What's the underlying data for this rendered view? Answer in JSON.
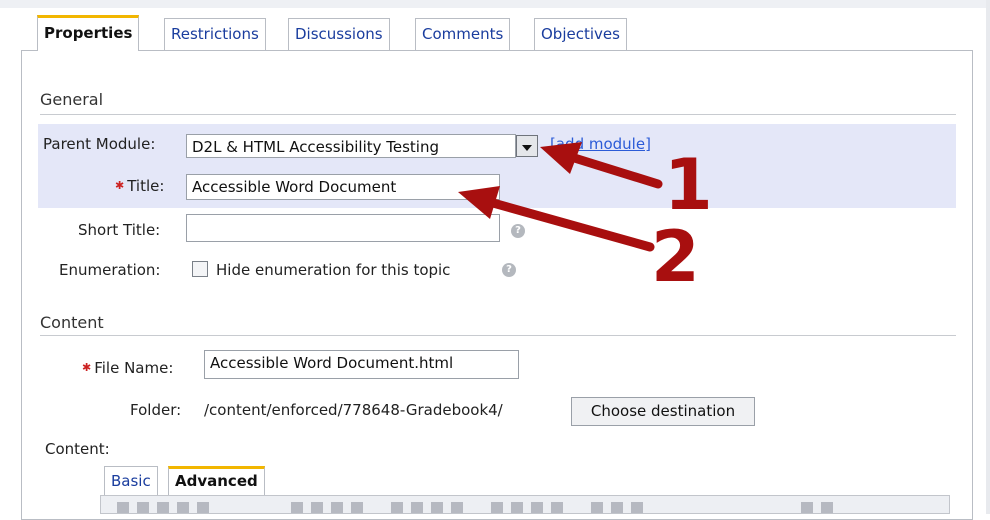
{
  "tabs": [
    "Properties",
    "Restrictions",
    "Discussions",
    "Comments",
    "Objectives"
  ],
  "general": {
    "heading": "General",
    "parent_module_label": "Parent Module:",
    "parent_module_value": "D2L & HTML Accessibility Testing",
    "add_module_link": "[add module]",
    "title_label": "Title:",
    "title_value": "Accessible Word Document",
    "short_title_label": "Short Title:",
    "short_title_value": "",
    "enumeration_label": "Enumeration:",
    "hide_enumeration_label": "Hide enumeration for this topic",
    "hide_enumeration_checked": false
  },
  "content": {
    "heading": "Content",
    "file_name_label": "File Name:",
    "file_name_value": "Accessible Word Document.html",
    "folder_label": "Folder:",
    "folder_value": "/content/enforced/778648-Gradebook4/",
    "choose_destination_button": "Choose destination",
    "content_label": "Content:",
    "editor_tabs": [
      "Basic",
      "Advanced"
    ]
  },
  "annotations": [
    "1",
    "2"
  ],
  "colors": {
    "active_tab_accent": "#f2b600",
    "highlight_band": "#e4e7f8",
    "link": "#2b5bd7",
    "annotation_red": "#a80f0f",
    "required_star": "#cc2222"
  }
}
